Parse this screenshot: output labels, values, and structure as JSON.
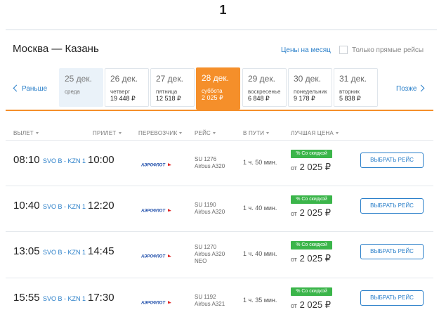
{
  "page_number": "1",
  "route_title": "Москва — Казань",
  "price_month_link": "Цены на месяц",
  "direct_only_label": "Только прямые рейсы",
  "nav": {
    "prev_label": "Раньше",
    "next_label": "Позже"
  },
  "days": [
    {
      "date": "25 дек.",
      "weekday": "среда",
      "price": "",
      "state": "past"
    },
    {
      "date": "26 дек.",
      "weekday": "четверг",
      "price": "19 448 ₽",
      "state": "normal"
    },
    {
      "date": "27 дек.",
      "weekday": "пятница",
      "price": "12 518 ₽",
      "state": "normal"
    },
    {
      "date": "28 дек.",
      "weekday": "суббота",
      "price": "2 025 ₽",
      "state": "selected"
    },
    {
      "date": "29 дек.",
      "weekday": "воскресенье",
      "price": "6 848 ₽",
      "state": "normal"
    },
    {
      "date": "30 дек.",
      "weekday": "понедельник",
      "price": "9 178 ₽",
      "state": "normal"
    },
    {
      "date": "31 дек.",
      "weekday": "вторник",
      "price": "5 838 ₽",
      "state": "normal"
    }
  ],
  "columns": {
    "departure": "ВЫЛЕТ",
    "arrival": "ПРИЛЕТ",
    "carrier": "ПЕРЕВОЗЧИК",
    "flight": "РЕЙС",
    "duration": "В ПУТИ",
    "best_price": "ЛУЧШАЯ ЦЕНА"
  },
  "carrier_logo_text": "АЭРОФЛОТ",
  "flights": [
    {
      "dep": "08:10",
      "route": "SVO B - KZN 1",
      "arr": "10:00",
      "number": "SU 1276",
      "aircraft": "Airbus A320",
      "aircraft_extra": "",
      "duration": "1 ч. 50 мин.",
      "badge": "% Со скидкой",
      "price_prefix": "от",
      "price": "2 025 ₽",
      "button": "ВЫБРАТЬ РЕЙС"
    },
    {
      "dep": "10:40",
      "route": "SVO B - KZN 1",
      "arr": "12:20",
      "number": "SU 1190",
      "aircraft": "Airbus A320",
      "aircraft_extra": "",
      "duration": "1 ч. 40 мин.",
      "badge": "% Со скидкой",
      "price_prefix": "от",
      "price": "2 025 ₽",
      "button": "ВЫБРАТЬ РЕЙС"
    },
    {
      "dep": "13:05",
      "route": "SVO B - KZN 1",
      "arr": "14:45",
      "number": "SU 1270",
      "aircraft": "Airbus A320",
      "aircraft_extra": "NEO",
      "duration": "1 ч. 40 мин.",
      "badge": "% Со скидкой",
      "price_prefix": "от",
      "price": "2 025 ₽",
      "button": "ВЫБРАТЬ РЕЙС"
    },
    {
      "dep": "15:55",
      "route": "SVO B - KZN 1",
      "arr": "17:30",
      "number": "SU 1192",
      "aircraft": "Airbus A321",
      "aircraft_extra": "",
      "duration": "1 ч. 35 мин.",
      "badge": "% Со скидкой",
      "price_prefix": "от",
      "price": "2 025 ₽",
      "button": "ВЫБРАТЬ РЕЙС"
    }
  ],
  "colors": {
    "accent_blue": "#2a7fc9",
    "selected_orange": "#f58f2a",
    "discount_green": "#3bb54a",
    "carrier_logo": "#1a4aa8"
  }
}
